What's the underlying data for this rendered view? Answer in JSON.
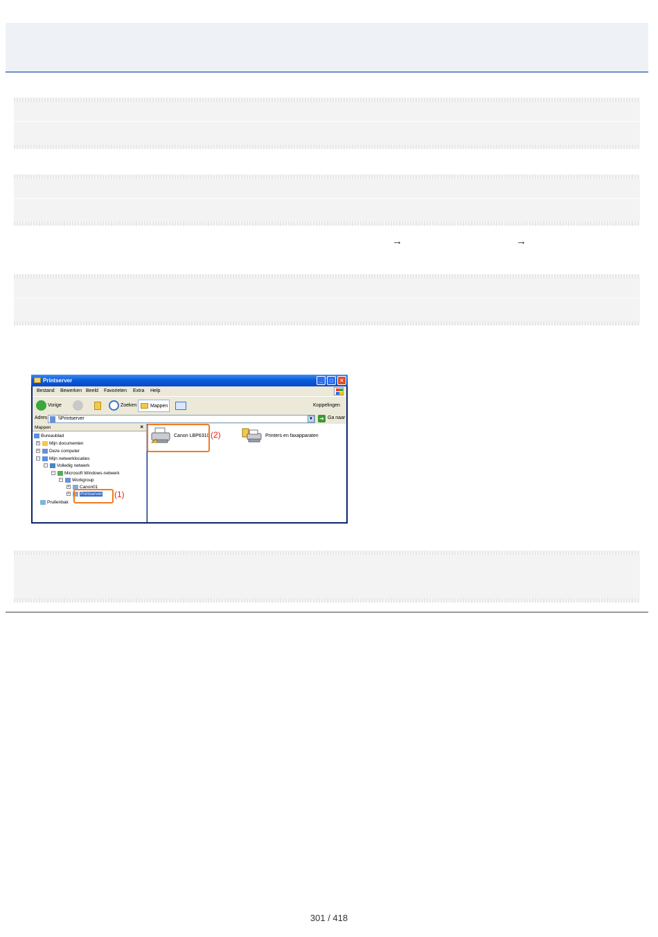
{
  "page": {
    "arrow_1": "→",
    "arrow_2": "→",
    "page_number": "301 / 418"
  },
  "window": {
    "title": "Printserver",
    "menu": [
      "Bestand",
      "Bewerken",
      "Beeld",
      "Favorieten",
      "Extra",
      "Help"
    ],
    "toolbar": {
      "back_label": "Vorige",
      "search_label": "Zoeken",
      "folders_label": "Mappen",
      "links_label": "Koppelingen"
    },
    "address": {
      "label": "Adres",
      "value": "\\\\Printserver",
      "go_label": "Ga naar"
    },
    "folder_pane": {
      "title": "Mappen",
      "close_glyph": "×",
      "items": [
        {
          "label": "Bureaublad"
        },
        {
          "label": "Mijn documenten"
        },
        {
          "label": "Deze computer"
        },
        {
          "label": "Mijn netwerklocaties"
        },
        {
          "label": "Volledig netwerk"
        },
        {
          "label": "Microsoft Windows-netwerk"
        },
        {
          "label": "Workgroup"
        },
        {
          "label": "Canon01"
        },
        {
          "label": "Printserver"
        },
        {
          "label": "Prullenbak"
        }
      ]
    },
    "content": {
      "items": [
        {
          "label": "Canon LBP6310"
        },
        {
          "label": "Printers en faxapparaten"
        }
      ]
    },
    "markers": {
      "one": "(1)",
      "two": "(2)"
    },
    "colors": {
      "callout": "#f07a1e",
      "marker_text": "#e3201b",
      "title_bar": "#0a5ddb"
    }
  }
}
